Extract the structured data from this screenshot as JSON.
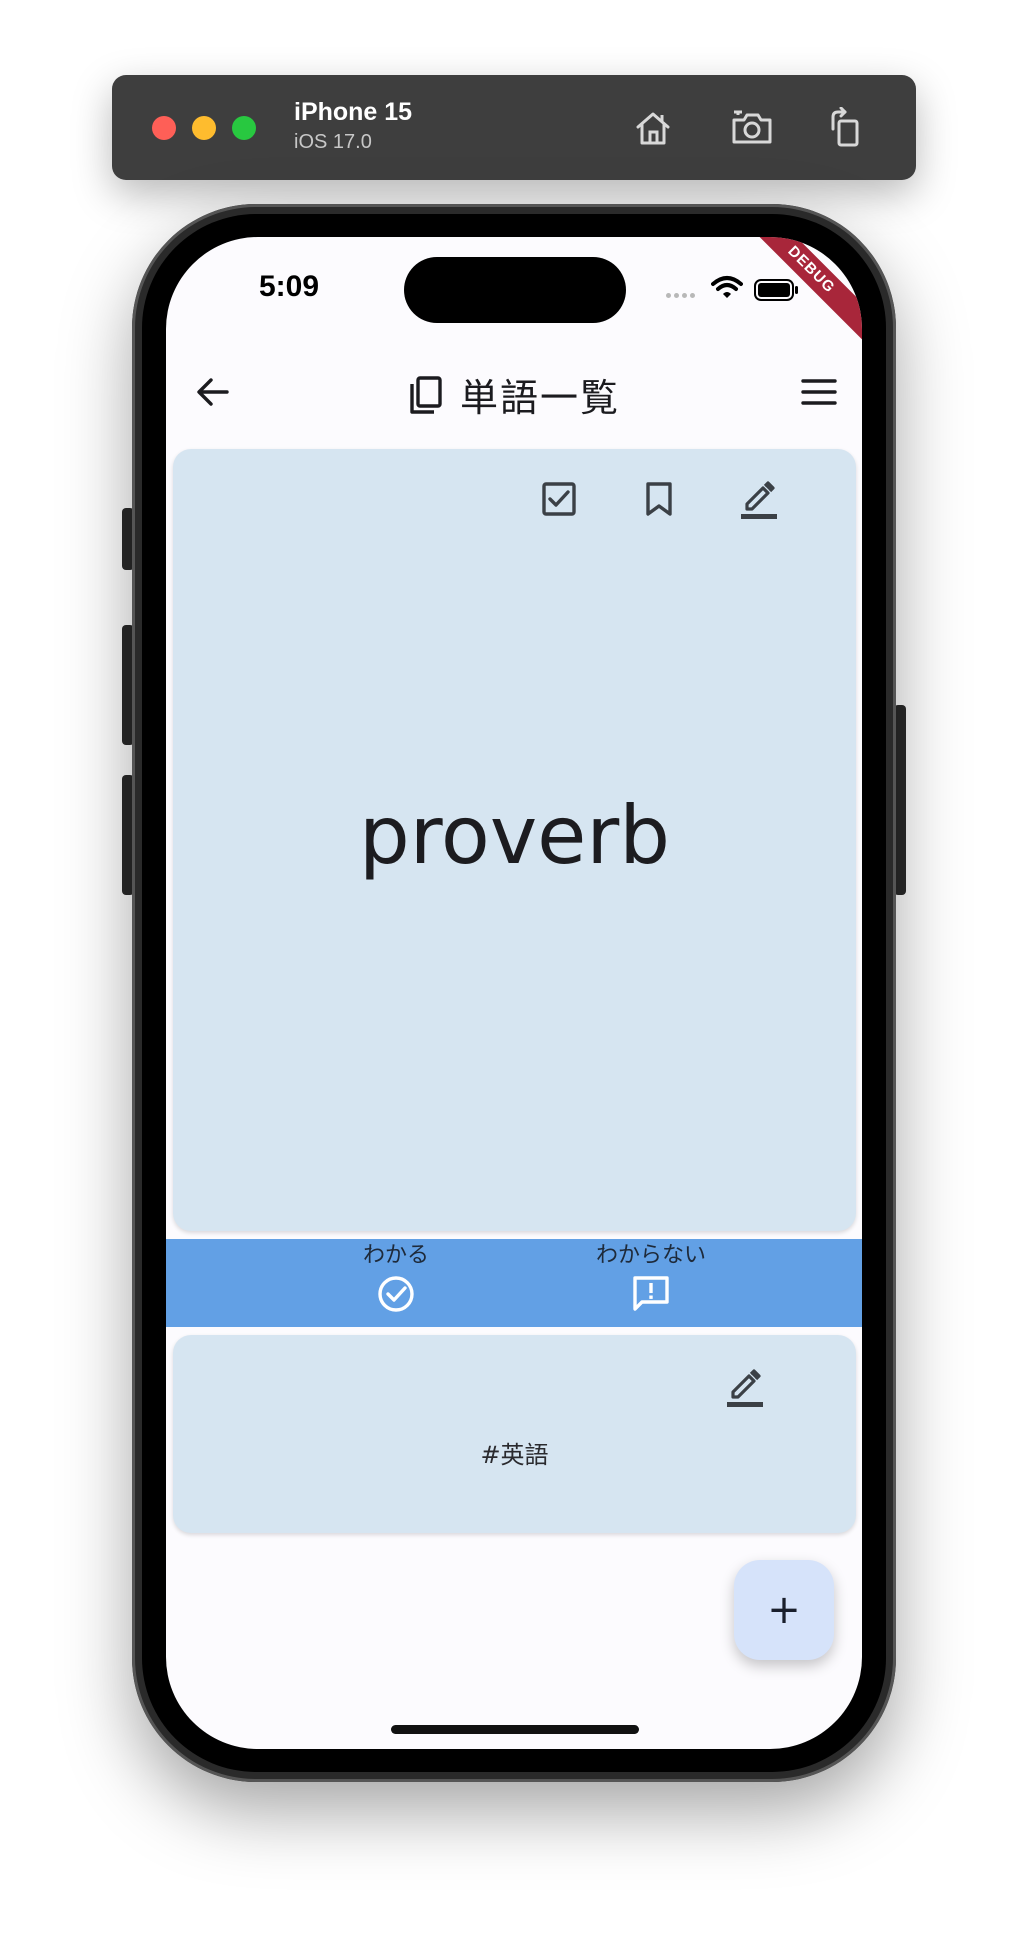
{
  "simulator": {
    "device_name": "iPhone 15",
    "os_version": "iOS 17.0"
  },
  "status_bar": {
    "time": "5:09",
    "debug_label": "DEBUG"
  },
  "app_bar": {
    "title": "単語一覧"
  },
  "word_card": {
    "word": "proverb"
  },
  "answer_bar": {
    "know_label": "わかる",
    "unknown_label": "わからない"
  },
  "tag_card": {
    "tag": "#英語"
  },
  "fab": {
    "label": "+"
  },
  "colors": {
    "card_bg": "#d6e5f1",
    "answer_bar_bg": "#62a0e5",
    "fab_bg": "#d6e3fa",
    "debug_banner": "#a8263a"
  },
  "icons": [
    "home-icon",
    "screenshot-icon",
    "rotate-icon",
    "back-arrow-icon",
    "copy-icon",
    "menu-icon",
    "checkbox-icon",
    "bookmark-icon",
    "edit-icon",
    "check-circle-icon",
    "feedback-icon",
    "wifi-icon",
    "battery-icon"
  ]
}
